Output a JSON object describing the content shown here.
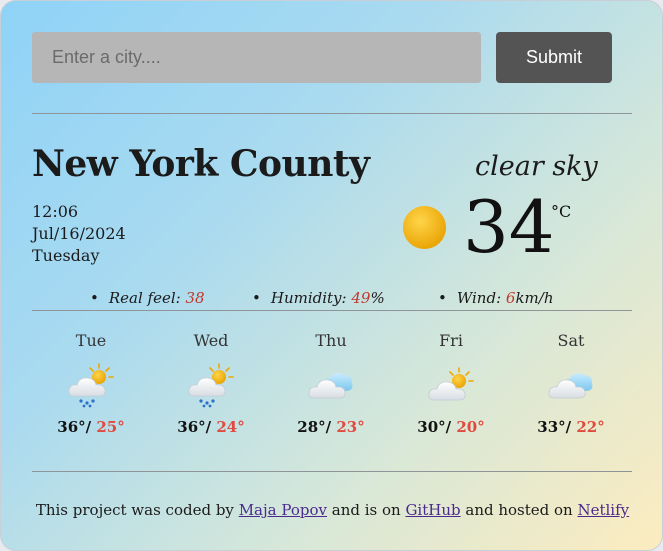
{
  "search": {
    "placeholder": "Enter a city....",
    "submit_label": "Submit"
  },
  "current": {
    "city": "New York County",
    "time": "12:06",
    "date": "Jul/16/2024",
    "weekday": "Tuesday",
    "description": "clear sky",
    "icon": "sun-icon",
    "temperature": "34",
    "unit": "°C"
  },
  "details": {
    "feel_label": "Real feel: ",
    "feel_value": "38",
    "humidity_label": "Humidity: ",
    "humidity_value": "49",
    "humidity_suffix": "%",
    "wind_label": "Wind: ",
    "wind_value": "6",
    "wind_suffix": "km/h"
  },
  "forecast": [
    {
      "day": "Tue",
      "icon": "rain-cloud-sun-icon",
      "max": "36°",
      "min": "25°"
    },
    {
      "day": "Wed",
      "icon": "rain-cloud-sun-icon",
      "max": "36°",
      "min": "24°"
    },
    {
      "day": "Thu",
      "icon": "cloud-icon",
      "max": "28°",
      "min": "23°"
    },
    {
      "day": "Fri",
      "icon": "cloud-sun-icon",
      "max": "30°",
      "min": "20°"
    },
    {
      "day": "Sat",
      "icon": "cloud-icon",
      "max": "33°",
      "min": "22°"
    }
  ],
  "footer": {
    "text1": "This project was coded by ",
    "author": "Maja Popov",
    "text2": " and is on ",
    "github": "GitHub",
    "text3": " and hosted on ",
    "netlify": "Netlify"
  },
  "colors": {
    "accent_red": "#c0392b",
    "button_bg": "#555454",
    "input_bg": "#b6b6b6"
  }
}
